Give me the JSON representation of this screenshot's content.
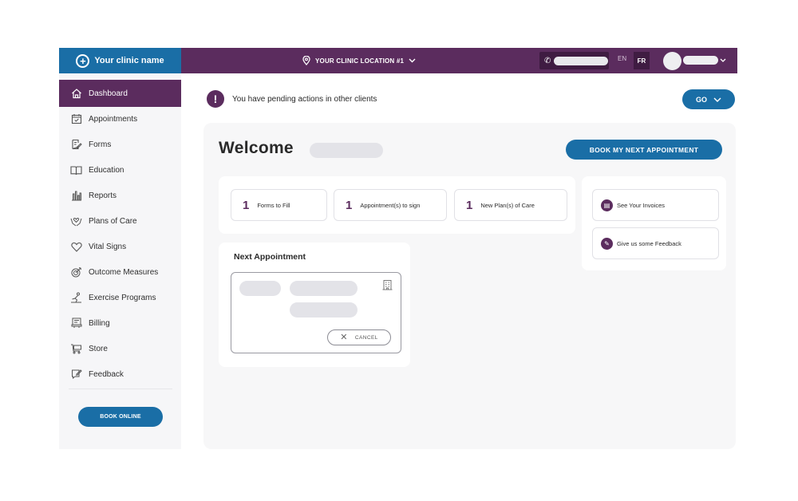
{
  "header": {
    "clinic_name": "Your clinic name",
    "location": "YOUR CLINIC LOCATION #1",
    "lang_en": "EN",
    "lang_fr": "FR"
  },
  "sidebar": {
    "items": [
      {
        "label": "Dashboard",
        "icon": "home-icon",
        "active": true
      },
      {
        "label": "Appointments",
        "icon": "calendar-check-icon"
      },
      {
        "label": "Forms",
        "icon": "form-edit-icon"
      },
      {
        "label": "Education",
        "icon": "book-icon"
      },
      {
        "label": "Reports",
        "icon": "chart-icon"
      },
      {
        "label": "Plans of Care",
        "icon": "hands-care-icon"
      },
      {
        "label": "Vital Signs",
        "icon": "heart-icon"
      },
      {
        "label": "Outcome Measures",
        "icon": "target-icon"
      },
      {
        "label": "Exercise Programs",
        "icon": "exercise-icon"
      },
      {
        "label": "Billing",
        "icon": "billing-icon"
      },
      {
        "label": "Store",
        "icon": "store-icon"
      },
      {
        "label": "Feedback",
        "icon": "feedback-icon"
      }
    ],
    "book_online": "BOOK ONLINE"
  },
  "notice": {
    "text": "You have pending actions in other clients",
    "go_label": "GO"
  },
  "main": {
    "welcome": "Welcome",
    "book_next": "BOOK MY NEXT APPOINTMENT",
    "stats": [
      {
        "count": "1",
        "label": "Forms to Fill"
      },
      {
        "count": "1",
        "label": "Appointment(s) to sign"
      },
      {
        "count": "1",
        "label": "New Plan(s) of Care"
      }
    ],
    "links": [
      {
        "label": "See Your Invoices",
        "icon": "invoice-icon"
      },
      {
        "label": "Give us some Feedback",
        "icon": "feedback-icon"
      }
    ],
    "next_appointment": {
      "title": "Next Appointment",
      "cancel": "CANCEL"
    }
  },
  "colors": {
    "primary_purple": "#5b2c5e",
    "primary_blue": "#1a6ea6"
  }
}
